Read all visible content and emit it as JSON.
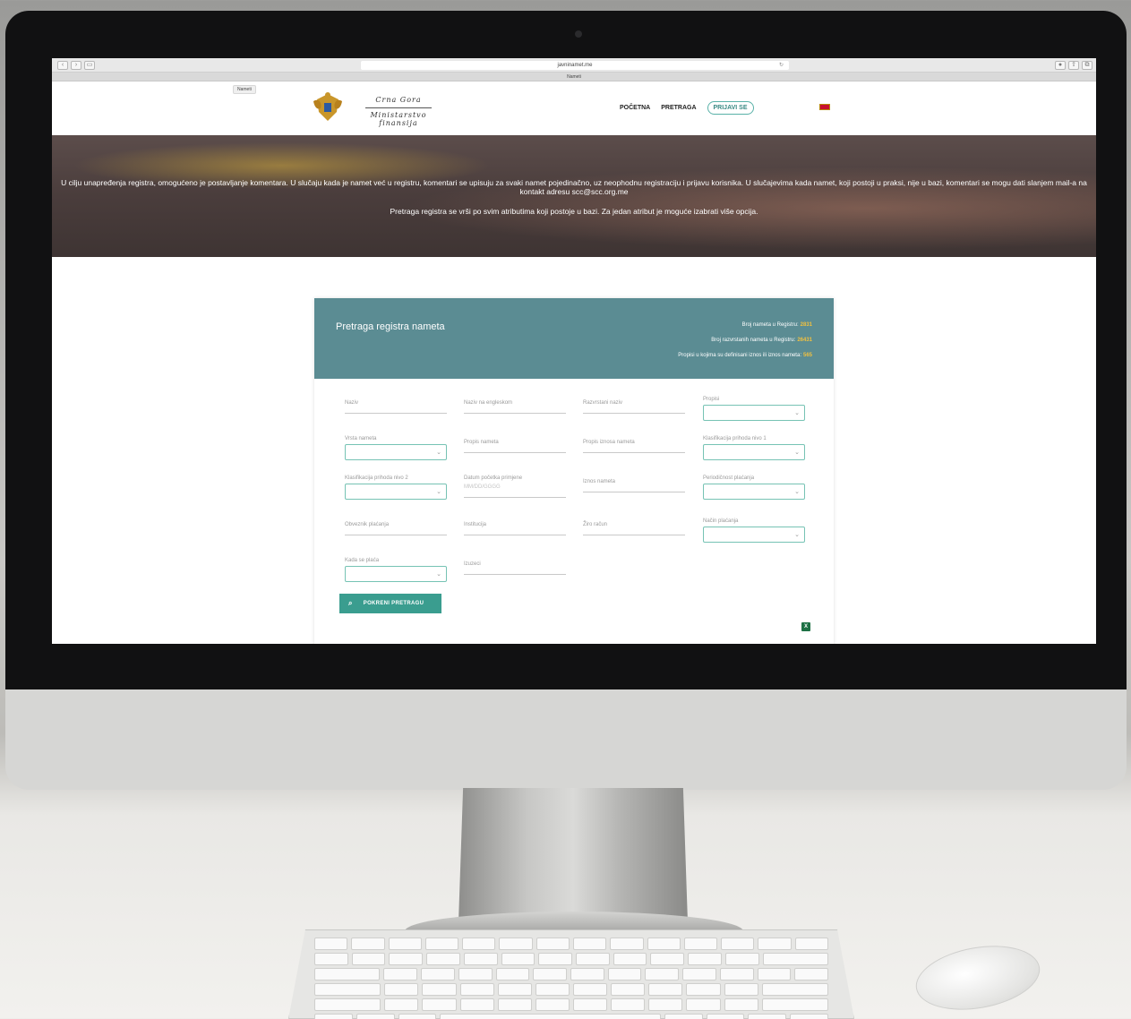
{
  "browser": {
    "url": "javninamet.me",
    "tab_title": "Nameti"
  },
  "header": {
    "badge": "Nameti",
    "brand_line1": "Crna Gora",
    "brand_line2": "Ministarstvo finansija",
    "nav": {
      "home": "POČETNA",
      "search": "PRETRAGA",
      "login": "PRIJAVI SE"
    },
    "colors": {
      "accent": "#59b1a8",
      "flag": "#c8102e"
    }
  },
  "hero": {
    "paragraph1": "U cilju unapređenja registra, omogućeno je postavljanje komentara. U slučaju kada je namet već u registru, komentari se upisuju za svaki namet pojedinačno, uz neophodnu registraciju i prijavu korisnika. U slučajevima kada namet, koji postoji u praksi, nije u bazi, komentari se mogu dati slanjem mail-a na kontakt adresu scc@scc.org.me",
    "paragraph2": "Pretraga registra se vrši po svim atributima koji postoje u bazi. Za jedan atribut je moguće izabrati više opcija."
  },
  "panel": {
    "title": "Pretraga registra nameta",
    "header_color": "#5b8c93",
    "stats": [
      {
        "label": "Broj nameta u Registru:",
        "value": "2831"
      },
      {
        "label": "Broj razvrstanih nameta u Registru:",
        "value": "26431"
      },
      {
        "label": "Propisi u kojima su definisani iznos ili iznos nameta:",
        "value": "565"
      }
    ],
    "fields": {
      "naziv": "Naziv",
      "naziv_en": "Naziv na engleskom",
      "razvrstani": "Razvrstani naziv",
      "propisi": "Propisi",
      "vrsta": "Vrsta nameta",
      "propis_nameta": "Propis nameta",
      "propis_iznosa": "Propis iznosa nameta",
      "klas1": "Klasifikacija prihoda nivo 1",
      "klas2": "Klasifikacija prihoda nivo 2",
      "datum": "Datum početka primjene",
      "datum_placeholder": "MM/DD/GGGG",
      "iznos": "Iznos nameta",
      "periodicnost": "Periodičnost plaćanja",
      "obveznik": "Obveznik plaćanja",
      "institucija": "Institucija",
      "ziro": "Žiro račun",
      "nacin": "Način plaćanja",
      "kada": "Kada se plaća",
      "izuzeci": "Izuzeci"
    },
    "search_button": "POKRENI PRETRAGU",
    "button_color": "#3a9d8f",
    "export_icon": "excel-icon"
  }
}
